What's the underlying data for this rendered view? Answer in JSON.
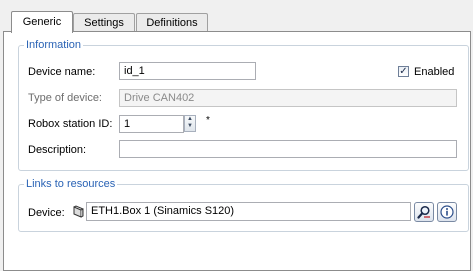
{
  "tabs": [
    {
      "label": "Generic"
    },
    {
      "label": "Settings"
    },
    {
      "label": "Definitions"
    }
  ],
  "information": {
    "title": "Information",
    "device_name_label": "Device name:",
    "device_name_value": "id_1",
    "enabled_label": "Enabled",
    "enabled_checked": true,
    "type_label": "Type of device:",
    "type_value": "Drive CAN402",
    "station_label": "Robox station ID:",
    "station_value": "1",
    "required_marker": "*",
    "description_label": "Description:",
    "description_value": ""
  },
  "links": {
    "title": "Links to resources",
    "device_label": "Device:",
    "device_value": "ETH1.Box 1 (Sinamics S120)",
    "device_icon": "device-icon",
    "browse_icon": "magnifier-icon",
    "info_icon": "info-icon"
  },
  "colors": {
    "group_title": "#2a63b5",
    "background": "#f0f0f0"
  }
}
